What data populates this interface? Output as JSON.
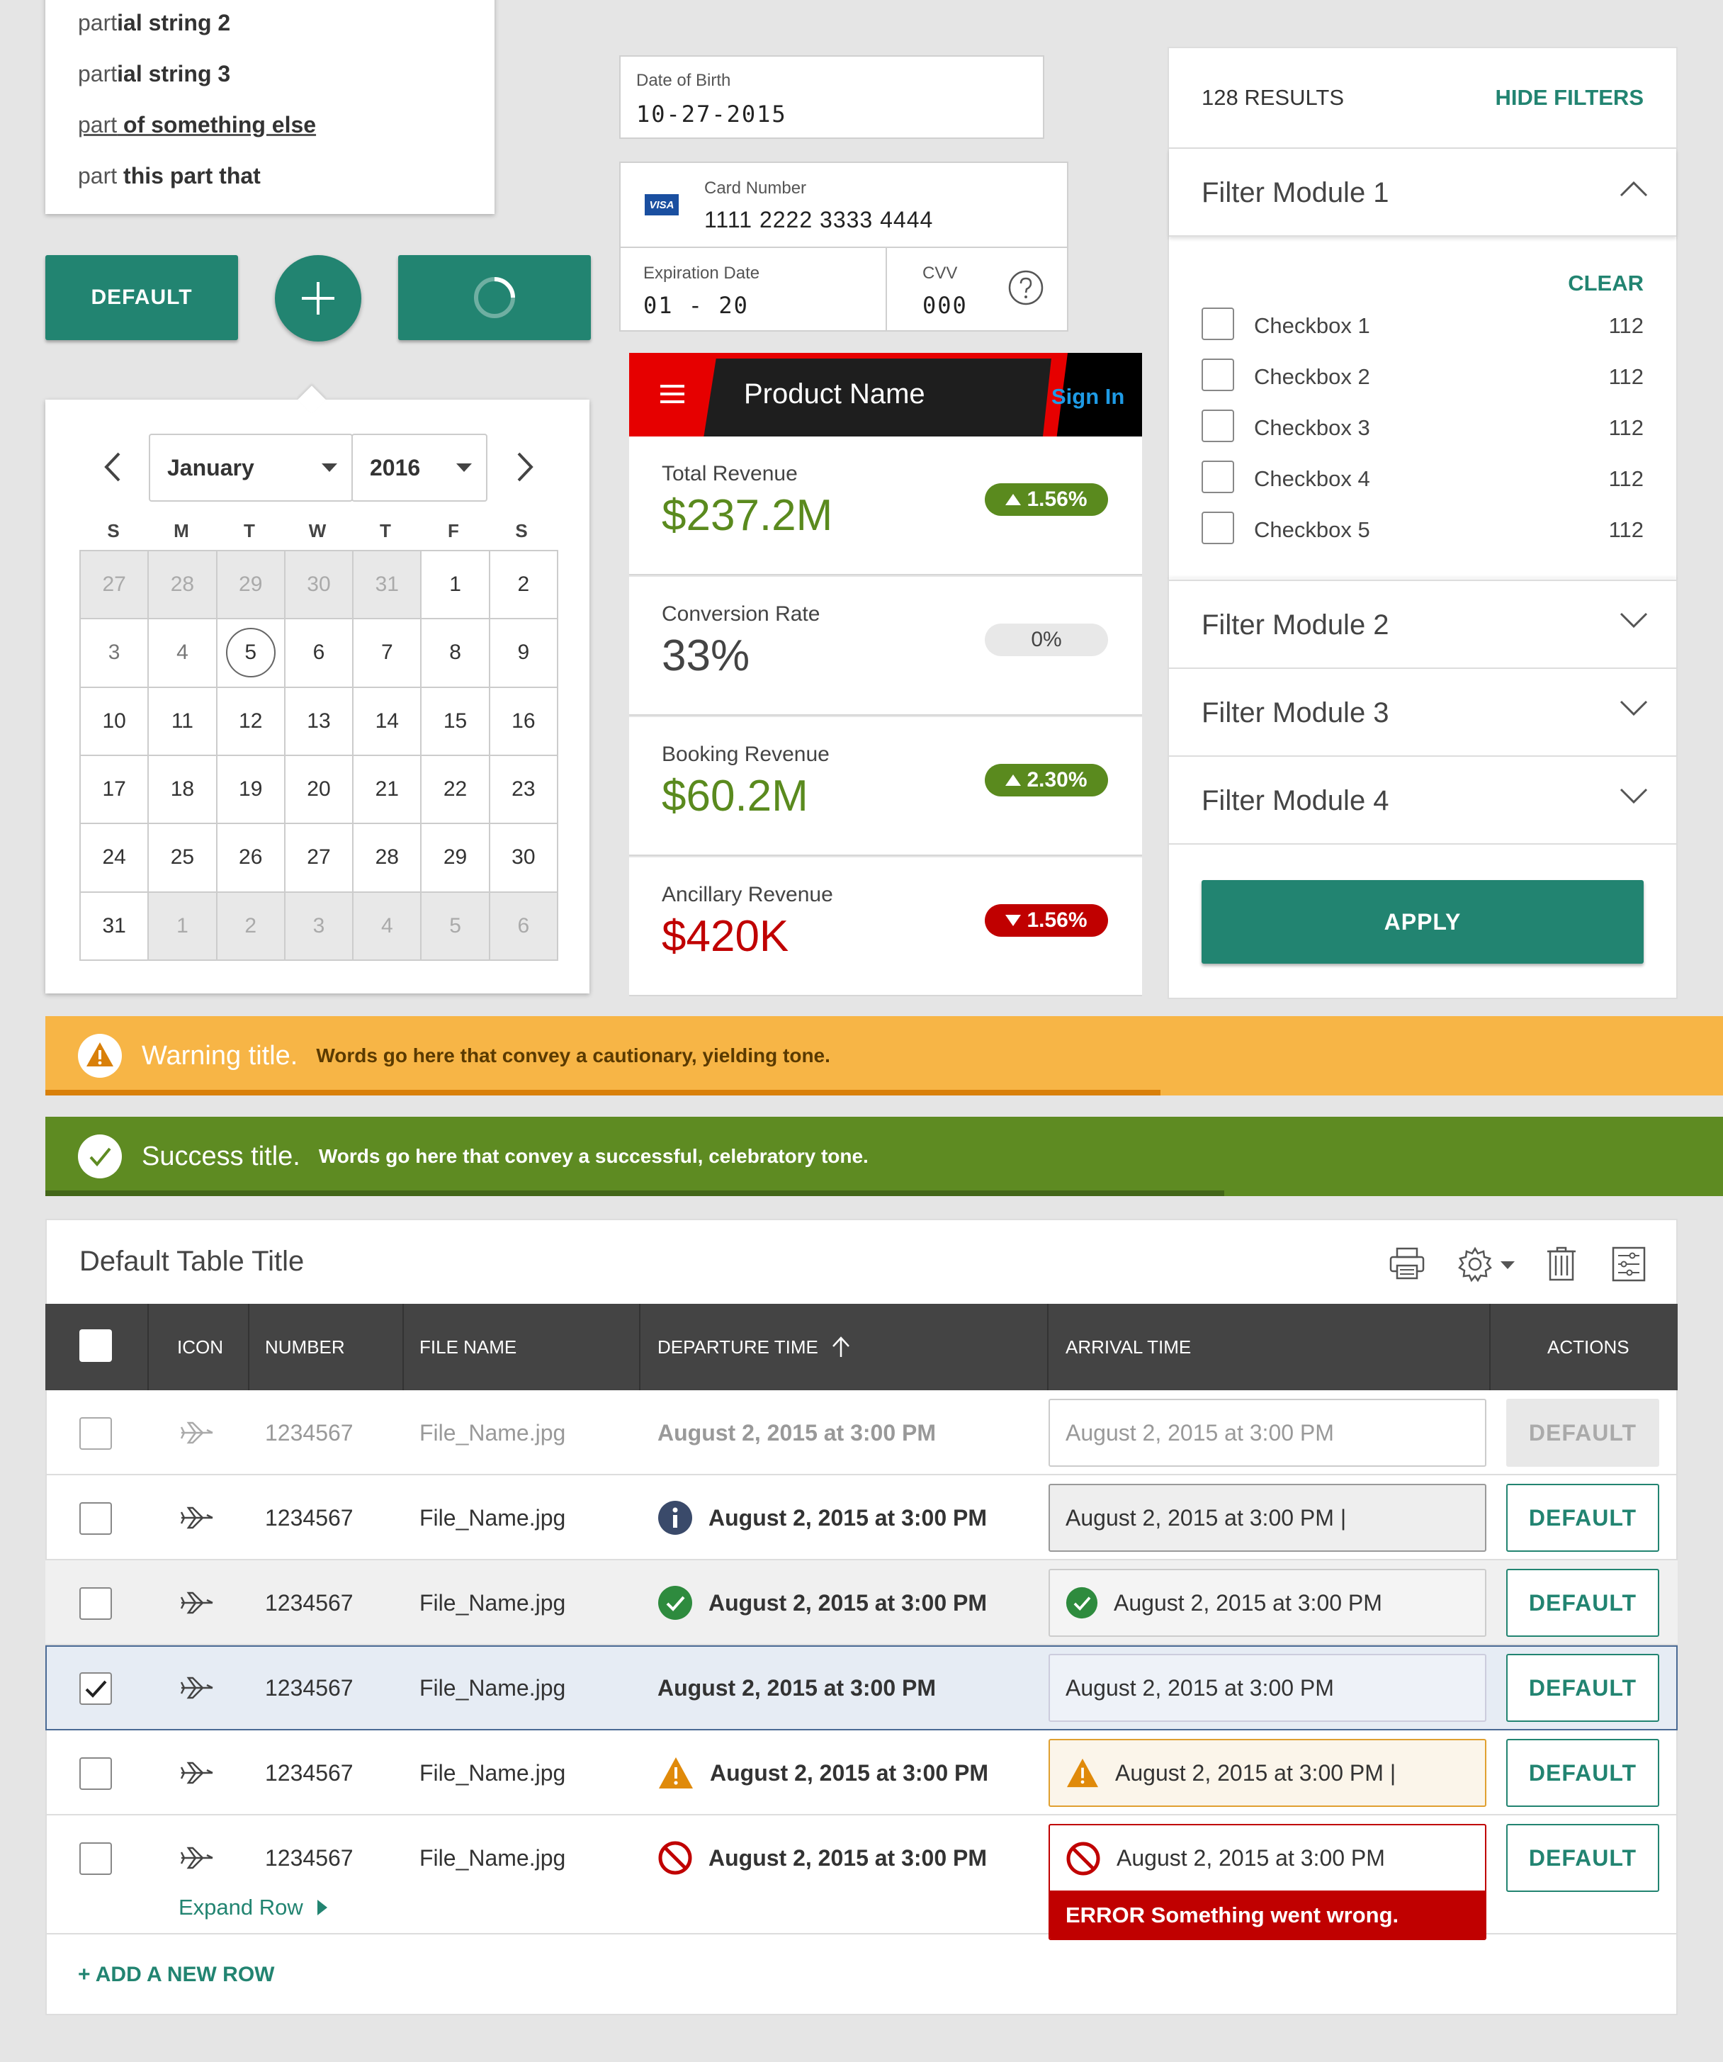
{
  "autocomplete": {
    "items": [
      {
        "pre": "part",
        "rest": "ial string 2"
      },
      {
        "pre": "part",
        "rest": "ial string 3"
      },
      {
        "pre": "part",
        "rest": " of something else"
      },
      {
        "pre": "part",
        "rest": " this part that"
      }
    ]
  },
  "buttons": {
    "default_label": "DEFAULT"
  },
  "calendar": {
    "month": "January",
    "year": "2016",
    "weekdays": [
      "S",
      "M",
      "T",
      "W",
      "T",
      "F",
      "S"
    ],
    "days": [
      "27",
      "28",
      "29",
      "30",
      "31",
      "1",
      "2",
      "3",
      "4",
      "5",
      "6",
      "7",
      "8",
      "9",
      "10",
      "11",
      "12",
      "13",
      "14",
      "15",
      "16",
      "17",
      "18",
      "19",
      "20",
      "21",
      "22",
      "23",
      "24",
      "25",
      "26",
      "27",
      "28",
      "29",
      "30",
      "31",
      "1",
      "2",
      "3",
      "4",
      "5",
      "6"
    ]
  },
  "dob": {
    "label": "Date of Birth",
    "value": "10-27-2015"
  },
  "card": {
    "brand": "VISA",
    "number_label": "Card Number",
    "number": "1111 2222 3333 4444",
    "exp_label": "Expiration Date",
    "exp": "01 - 20",
    "cvv_label": "CVV",
    "cvv": "000"
  },
  "dashboard": {
    "product_name": "Product Name",
    "sign_in": "Sign In",
    "kpis": [
      {
        "label": "Total Revenue",
        "value": "$237.2M",
        "change": "1.56%"
      },
      {
        "label": "Conversion Rate",
        "value": "33%",
        "change": "0%"
      },
      {
        "label": "Booking Revenue",
        "value": "$60.2M",
        "change": "2.30%"
      },
      {
        "label": "Ancillary Revenue",
        "value": "$420K",
        "change": "1.56%"
      }
    ],
    "colors": {
      "up": "#5a8a1e",
      "down": "#c00000",
      "neutral": "#e8e8e8",
      "red_accent": "#e60000"
    }
  },
  "filters": {
    "results": "128 RESULTS",
    "hide": "HIDE FILTERS",
    "clear": "CLEAR",
    "modules": [
      "Filter Module 1",
      "Filter Module 2",
      "Filter Module 3",
      "Filter Module 4"
    ],
    "checkboxes": [
      {
        "label": "Checkbox 1",
        "count": "112"
      },
      {
        "label": "Checkbox 2",
        "count": "112"
      },
      {
        "label": "Checkbox 3",
        "count": "112"
      },
      {
        "label": "Checkbox 4",
        "count": "112"
      },
      {
        "label": "Checkbox 5",
        "count": "112"
      }
    ],
    "apply": "APPLY"
  },
  "alerts": {
    "warning": {
      "title": "Warning title.",
      "message": "Words go here that convey a cautionary, yielding tone.",
      "color": "#f7b546"
    },
    "success": {
      "title": "Success title.",
      "message": "Words go here that convey a successful, celebratory tone.",
      "color": "#5e8b22"
    }
  },
  "table": {
    "title": "Default Table Title",
    "columns": [
      "ICON",
      "NUMBER",
      "FILE NAME",
      "DEPARTURE TIME",
      "ARRIVAL TIME",
      "ACTIONS"
    ],
    "rows": [
      {
        "number": "1234567",
        "file": "File_Name.jpg",
        "departure": "August 2, 2015 at 3:00 PM",
        "arrival": "August 2, 2015 at 3:00 PM",
        "action": "DEFAULT"
      },
      {
        "number": "1234567",
        "file": "File_Name.jpg",
        "departure": "August 2, 2015 at 3:00 PM",
        "arrival": "August 2, 2015 at 3:00 PM |",
        "action": "DEFAULT"
      },
      {
        "number": "1234567",
        "file": "File_Name.jpg",
        "departure": "August 2, 2015 at 3:00 PM",
        "arrival": "August 2, 2015 at 3:00 PM",
        "action": "DEFAULT"
      },
      {
        "number": "1234567",
        "file": "File_Name.jpg",
        "departure": "August 2, 2015 at 3:00 PM",
        "arrival": "August 2, 2015 at 3:00 PM",
        "action": "DEFAULT"
      },
      {
        "number": "1234567",
        "file": "File_Name.jpg",
        "departure": "August 2, 2015 at 3:00 PM",
        "arrival": "August 2, 2015 at 3:00 PM |",
        "action": "DEFAULT"
      },
      {
        "number": "1234567",
        "file": "File_Name.jpg",
        "departure": "August 2, 2015 at 3:00 PM",
        "arrival": "August 2, 2015 at 3:00 PM",
        "action": "DEFAULT"
      }
    ],
    "expand_row": "Expand Row",
    "error": "ERROR Something went wrong.",
    "add_row": "+ ADD A NEW ROW"
  },
  "colors": {
    "teal": "#228471",
    "dark_header": "#444444"
  }
}
